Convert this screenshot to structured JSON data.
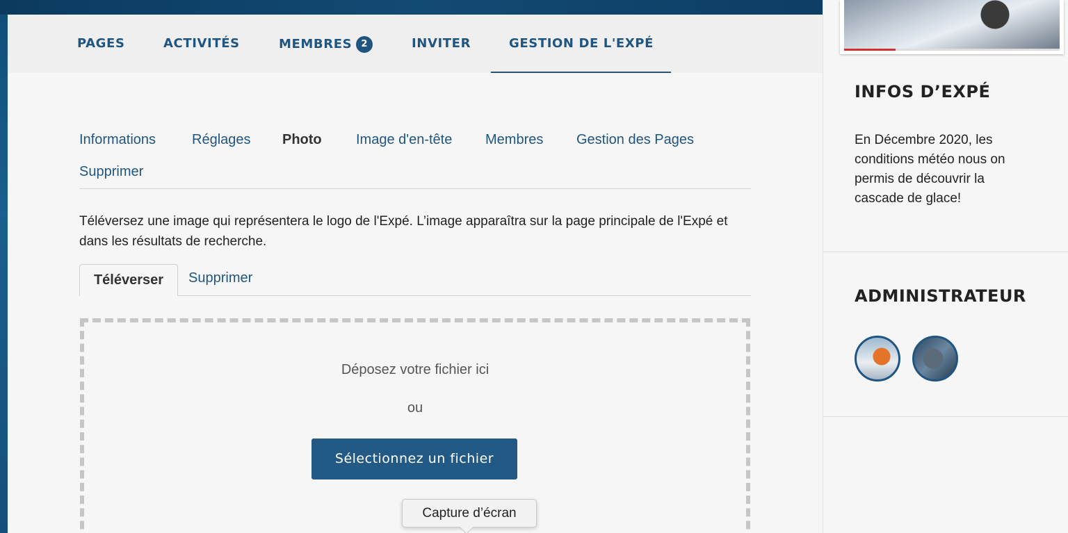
{
  "nav": {
    "items": [
      "PAGES",
      "ACTIVITÉS",
      "MEMBRES",
      "INVITER",
      "GESTION DE L'EXPÉ"
    ],
    "members_badge": "2",
    "active": "GESTION DE L'EXPÉ"
  },
  "subnav": {
    "items": [
      "Informations",
      "Réglages",
      "Photo",
      "Image d'en-tête",
      "Membres",
      "Gestion des Pages",
      "Supprimer"
    ],
    "active": "Photo"
  },
  "description": "Téléversez une image qui représentera le logo de l'Expé. L’image apparaîtra sur la page principale de l'Expé et dans les résultats de recherche.",
  "tabs": [
    "Téléverser",
    "Supprimer"
  ],
  "dropzone": {
    "title": "Déposez votre fichier ici",
    "or": "ou",
    "button": "Sélectionnez un fichier"
  },
  "tooltip": "Capture d’écran",
  "sidebar": {
    "photo_progress": 0.24,
    "infos_title": "INFOS D’EXPÉ",
    "infos_text": "En Décembre 2020, les conditions météo nous on permis de découvrir la cascade de glace!",
    "admin_title": "ADMINISTRATEUR"
  },
  "colors": {
    "accent": "#1f5580",
    "button": "#235a85",
    "banner": "#0b3a5e"
  }
}
